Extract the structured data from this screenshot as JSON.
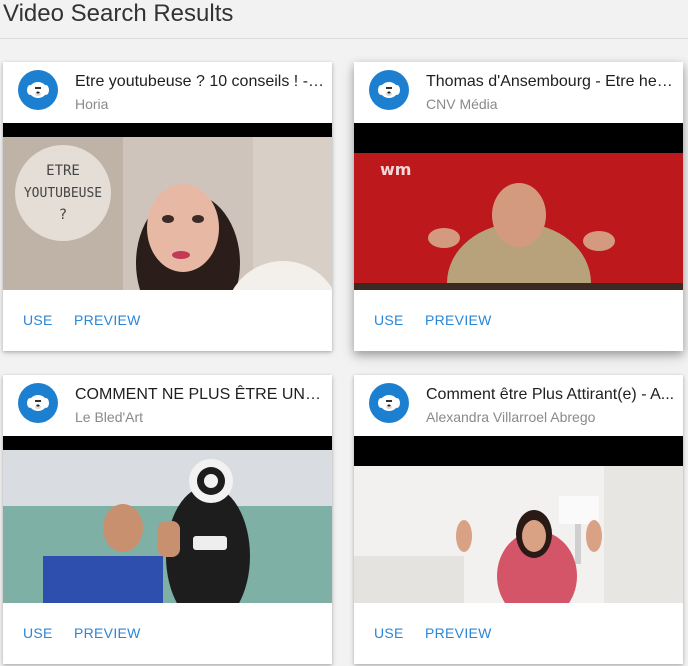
{
  "page": {
    "title": "Video Search Results"
  },
  "colors": {
    "accent": "#2a86d6",
    "avatar_bg": "#1d7fd0"
  },
  "actions": {
    "use_label": "USE",
    "preview_label": "PREVIEW"
  },
  "results": [
    {
      "title": "Etre youtubeuse ? 10 conseils ! - ...",
      "channel": "Horia",
      "thumbnail_overlay_text": [
        "ETRE",
        "YOUTUBEUSE",
        "?"
      ],
      "avatar_icon": "sheep-dog-icon"
    },
    {
      "title": "Thomas d'Ansembourg - Etre heu...",
      "channel": "CNV Média",
      "thumbnail_overlay_text": [
        "wm"
      ],
      "avatar_icon": "sheep-dog-icon"
    },
    {
      "title": "COMMENT NE PLUS ÊTRE UNE V...",
      "channel": "Le Bled'Art",
      "thumbnail_overlay_text": [],
      "avatar_icon": "sheep-dog-icon"
    },
    {
      "title": "Comment être Plus Attirant(e) - A...",
      "channel": "Alexandra Villarroel Abrego",
      "thumbnail_overlay_text": [],
      "avatar_icon": "sheep-dog-icon"
    }
  ]
}
